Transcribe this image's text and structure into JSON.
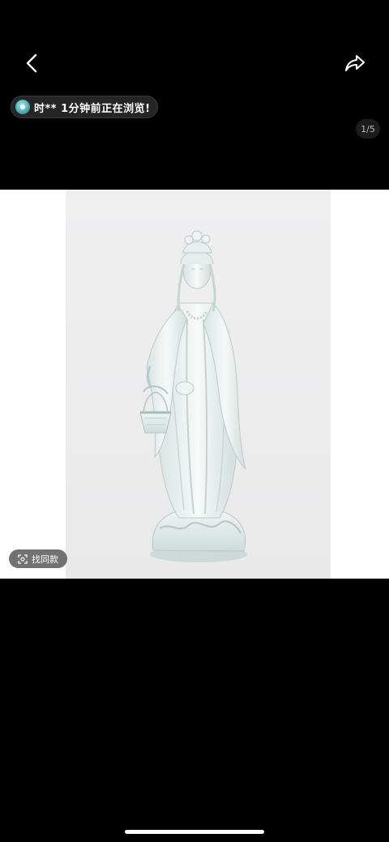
{
  "nav": {
    "back_icon": "chevron-left-icon",
    "share_icon": "share-arrow-icon"
  },
  "viewer_notice": {
    "user": "时**",
    "message": "1分钟前正在浏览!"
  },
  "gallery": {
    "counter": "1/5",
    "image_subject": "white porcelain Guanyin figure holding a basket",
    "find_similar_label": "找同款",
    "find_similar_icon": "scan-icon"
  },
  "colors": {
    "background": "#000000",
    "pill_bg": "#282828",
    "photo_bg": "#ededee"
  }
}
